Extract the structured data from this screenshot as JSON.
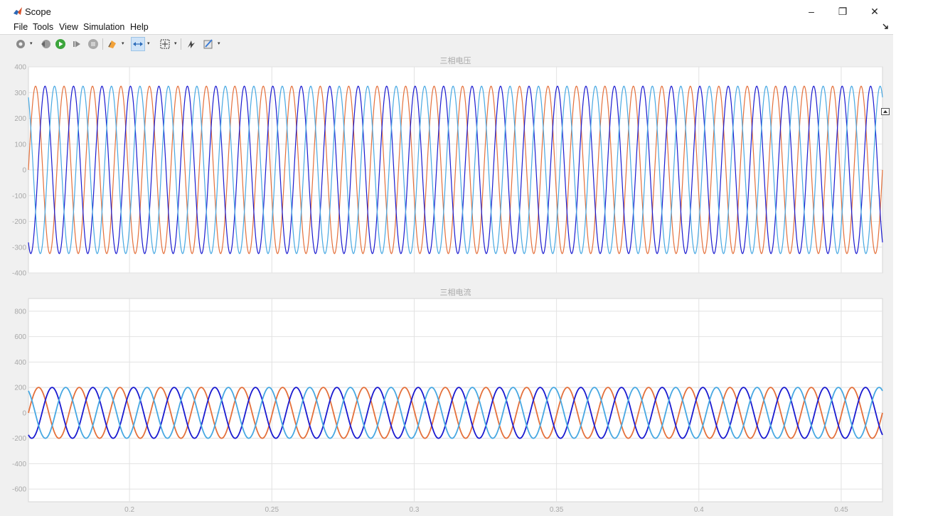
{
  "window": {
    "title": "Scope",
    "icon": "matlab-icon",
    "controls": {
      "minimize": "–",
      "restore": "❐",
      "close": "✕"
    }
  },
  "menu": [
    "File",
    "Tools",
    "View",
    "Simulation",
    "Help"
  ],
  "toolbar": [
    "settings-icon",
    "step-back-icon",
    "run-icon",
    "step-forward-icon",
    "stop-icon",
    "highlight-icon",
    "zoom-icon",
    "fit-to-view-icon",
    "triggers-icon",
    "style-icon"
  ],
  "colors": {
    "phase_a": "#e4703b",
    "phase_b": "#1a1ad0",
    "phase_c": "#47a8e2",
    "axes_bg": "#ffffff",
    "grid": "#e2e2e2",
    "axis_text": "#a8a8a8"
  },
  "chart_data": [
    {
      "type": "line",
      "title": "三相电压",
      "xlim": [
        0.1645,
        0.4645
      ],
      "ylim": [
        -400,
        400
      ],
      "yticks": [
        "400",
        "300",
        "200",
        "100",
        "0",
        "-100",
        "-200",
        "-300",
        "-400"
      ],
      "ytick_values": [
        400,
        300,
        200,
        100,
        0,
        -100,
        -200,
        -300,
        -400
      ],
      "xticks": [],
      "frequency_hz": 100,
      "series": [
        {
          "amplitude": 325,
          "phase_deg": 0,
          "color": "#e4703b"
        },
        {
          "amplitude": 325,
          "phase_deg": -120,
          "color": "#1a1ad0"
        },
        {
          "amplitude": 325,
          "phase_deg": 120,
          "color": "#47a8e2"
        }
      ]
    },
    {
      "type": "line",
      "title": "三相电流",
      "xlim": [
        0.1645,
        0.4645
      ],
      "ylim": [
        -700,
        900
      ],
      "yticks": [
        "800",
        "600",
        "400",
        "200",
        "0",
        "-200",
        "-400",
        "-600"
      ],
      "ytick_values": [
        800,
        600,
        400,
        200,
        0,
        -200,
        -400,
        -600
      ],
      "xticks": [
        "0.2",
        "0.25",
        "0.3",
        "0.35",
        "0.4",
        "0.45"
      ],
      "xtick_values": [
        0.2,
        0.25,
        0.3,
        0.35,
        0.4,
        0.45
      ],
      "frequency_hz": 70,
      "series": [
        {
          "amplitude": 200,
          "phase_deg": 0,
          "color": "#e4703b"
        },
        {
          "amplitude": 200,
          "phase_deg": -120,
          "color": "#1a1ad0"
        },
        {
          "amplitude": 200,
          "phase_deg": 120,
          "color": "#47a8e2"
        }
      ]
    }
  ]
}
